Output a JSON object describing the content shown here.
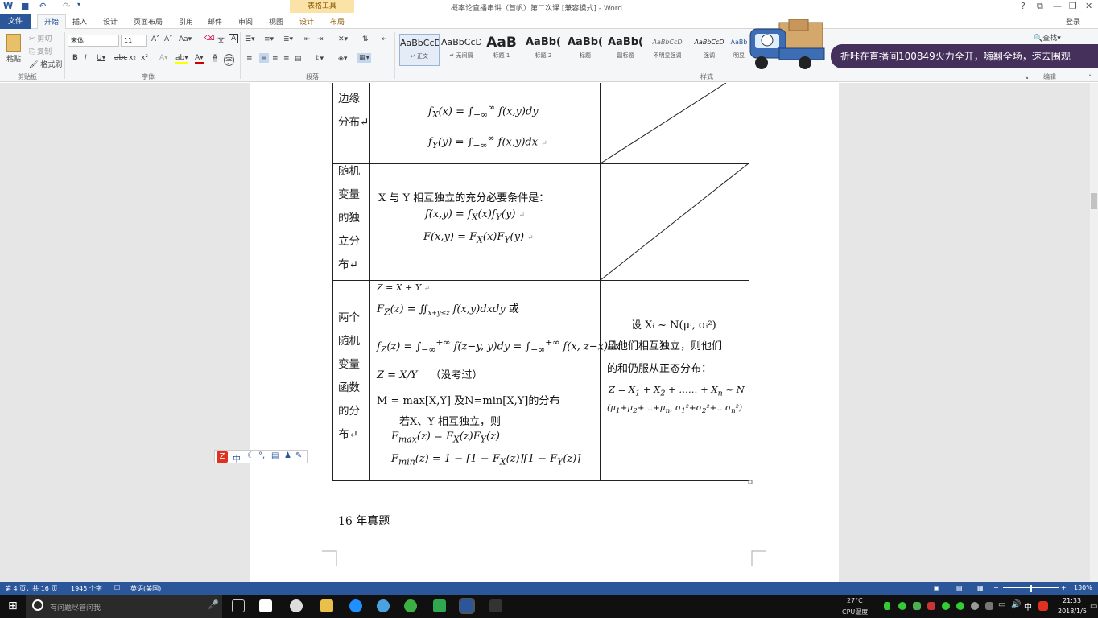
{
  "window": {
    "title": "概率论直播串讲（首帆）第二次课 [兼容模式] - Word",
    "context_tab_group": "表格工具",
    "controls": [
      "?",
      "⧉",
      "—",
      "❐",
      "✕"
    ]
  },
  "quick_access": {
    "undo": "↶",
    "redo": "↷",
    "more": "▾"
  },
  "tabs": [
    "文件",
    "开始",
    "插入",
    "设计",
    "页面布局",
    "引用",
    "邮件",
    "审阅",
    "视图",
    "设计",
    "布局"
  ],
  "login": "登录",
  "ribbon": {
    "clipboard": {
      "paste": "粘贴",
      "cut": "剪切",
      "copy": "复制",
      "format_painter": "格式刷",
      "group": "剪贴板"
    },
    "font": {
      "name": "宋体",
      "size": "11",
      "group": "字体"
    },
    "paragraph": {
      "group": "段落"
    },
    "styles": {
      "group": "样式",
      "items": [
        {
          "sample": "AaBbCcD",
          "name": "↵ 正文"
        },
        {
          "sample": "AaBbCcD",
          "name": "↵ 无间隔"
        },
        {
          "sample": "AaB",
          "name": "标题 1"
        },
        {
          "sample": "AaBb(",
          "name": "标题 2"
        },
        {
          "sample": "AaBb(",
          "name": "标题"
        },
        {
          "sample": "AaBb(",
          "name": "副标题"
        },
        {
          "sample": "AaBbCcD",
          "name": "不明显强调"
        },
        {
          "sample": "AaBbCcD",
          "name": "强调"
        },
        {
          "sample": "AaBb",
          "name": "明显"
        }
      ]
    },
    "editing": {
      "find": "查找",
      "group": "编辑"
    }
  },
  "stream_banner": "祈咔在直播间100849火力全开，嗨翻全场，速去围观",
  "document": {
    "row1_label": [
      "边缘",
      "分布↵"
    ],
    "row2_label": [
      "随机",
      "变量",
      "的独",
      "立分",
      "布↵"
    ],
    "row2_text": "X 与 Y 相互独立的充分必要条件是：",
    "row3_label": [
      "两个",
      "随机",
      "变量",
      "函数",
      "的分",
      "布↵"
    ],
    "row3_or": "或",
    "row3_note": "（没考过）",
    "row3_minmax": "M = max[X,Y] 及N=min[X,Y]的分布",
    "row3_indep": "若X、Y 相互独立，则",
    "right3_line1": "设 Xᵢ ~ N(μᵢ, σᵢ²)",
    "right3_line2": "且他们相互独立，则他们",
    "right3_line3": "的和仍服从正态分布：",
    "heading": "16 年真题"
  },
  "status": {
    "page": "第 4 页，共 16 页",
    "words": "1945 个字",
    "lang": "英语(美国)",
    "zoom": "130%"
  },
  "taskbar": {
    "search_placeholder": "有问题尽管问我",
    "temp": "27°C",
    "temp_label": "CPU温度",
    "ime": "中",
    "time": "21:33",
    "date": "2018/1/5"
  },
  "colors": {
    "word_blue": "#2b579a",
    "banner": "#44305a"
  }
}
